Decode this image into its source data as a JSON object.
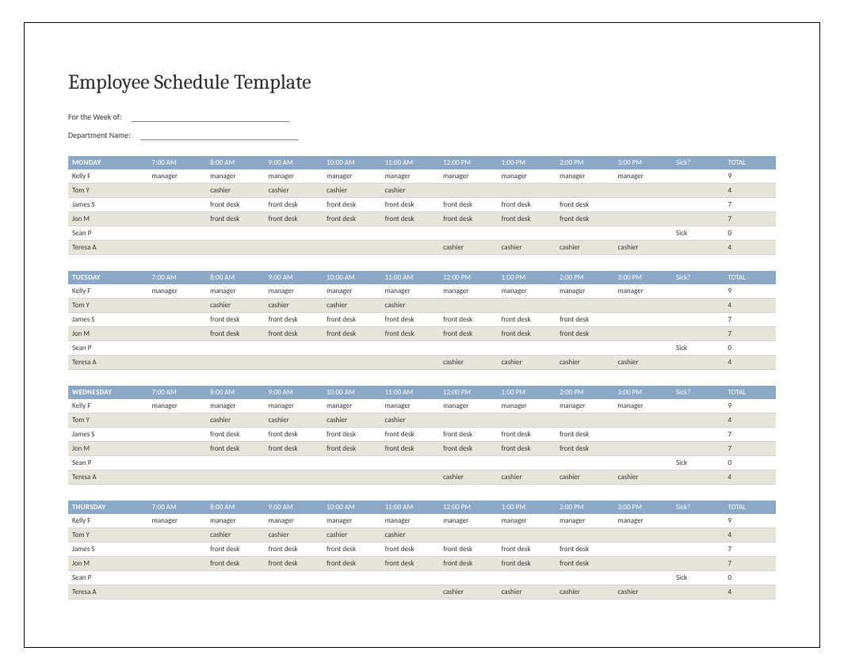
{
  "title": "Employee Schedule Template",
  "fields": {
    "week_label": "For the Week of:",
    "dept_label": "Department Name:"
  },
  "columns": {
    "hours": [
      "7:00 AM",
      "8:00 AM",
      "9:00 AM",
      "10:00 AM",
      "11:00 AM",
      "12:00 PM",
      "1:00 PM",
      "2:00 PM",
      "3:00 PM"
    ],
    "sick": "Sick?",
    "total": "TOTAL"
  },
  "days": [
    {
      "name": "MONDAY",
      "rows": [
        {
          "employee": "Kelly F",
          "cells": [
            "manager",
            "manager",
            "manager",
            "manager",
            "manager",
            "manager",
            "manager",
            "manager",
            "manager"
          ],
          "sick": "",
          "total": "9"
        },
        {
          "employee": "Tom Y",
          "cells": [
            "",
            "cashier",
            "cashier",
            "cashier",
            "cashier",
            "",
            "",
            "",
            ""
          ],
          "sick": "",
          "total": "4"
        },
        {
          "employee": "James S",
          "cells": [
            "",
            "front desk",
            "front desk",
            "front desk",
            "front desk",
            "front desk",
            "front desk",
            "front desk",
            ""
          ],
          "sick": "",
          "total": "7"
        },
        {
          "employee": "Jon M",
          "cells": [
            "",
            "front desk",
            "front desk",
            "front desk",
            "front desk",
            "front desk",
            "front desk",
            "front desk",
            ""
          ],
          "sick": "",
          "total": "7"
        },
        {
          "employee": "Sean P",
          "cells": [
            "",
            "",
            "",
            "",
            "",
            "",
            "",
            "",
            ""
          ],
          "sick": "Sick",
          "total": "0"
        },
        {
          "employee": "Teresa A",
          "cells": [
            "",
            "",
            "",
            "",
            "",
            "cashier",
            "cashier",
            "cashier",
            "cashier"
          ],
          "sick": "",
          "total": "4"
        }
      ]
    },
    {
      "name": "TUESDAY",
      "rows": [
        {
          "employee": "Kelly F",
          "cells": [
            "manager",
            "manager",
            "manager",
            "manager",
            "manager",
            "manager",
            "manager",
            "manager",
            "manager"
          ],
          "sick": "",
          "total": "9"
        },
        {
          "employee": "Tom Y",
          "cells": [
            "",
            "cashier",
            "cashier",
            "cashier",
            "cashier",
            "",
            "",
            "",
            ""
          ],
          "sick": "",
          "total": "4"
        },
        {
          "employee": "James S",
          "cells": [
            "",
            "front desk",
            "front desk",
            "front desk",
            "front desk",
            "front desk",
            "front desk",
            "front desk",
            ""
          ],
          "sick": "",
          "total": "7"
        },
        {
          "employee": "Jon M",
          "cells": [
            "",
            "front desk",
            "front desk",
            "front desk",
            "front desk",
            "front desk",
            "front desk",
            "front desk",
            ""
          ],
          "sick": "",
          "total": "7"
        },
        {
          "employee": "Sean P",
          "cells": [
            "",
            "",
            "",
            "",
            "",
            "",
            "",
            "",
            ""
          ],
          "sick": "Sick",
          "total": "0"
        },
        {
          "employee": "Teresa A",
          "cells": [
            "",
            "",
            "",
            "",
            "",
            "cashier",
            "cashier",
            "cashier",
            "cashier"
          ],
          "sick": "",
          "total": "4"
        }
      ]
    },
    {
      "name": "WEDNESDAY",
      "rows": [
        {
          "employee": "Kelly F",
          "cells": [
            "manager",
            "manager",
            "manager",
            "manager",
            "manager",
            "manager",
            "manager",
            "manager",
            "manager"
          ],
          "sick": "",
          "total": "9"
        },
        {
          "employee": "Tom Y",
          "cells": [
            "",
            "cashier",
            "cashier",
            "cashier",
            "cashier",
            "",
            "",
            "",
            ""
          ],
          "sick": "",
          "total": "4"
        },
        {
          "employee": "James S",
          "cells": [
            "",
            "front desk",
            "front desk",
            "front desk",
            "front desk",
            "front desk",
            "front desk",
            "front desk",
            ""
          ],
          "sick": "",
          "total": "7"
        },
        {
          "employee": "Jon M",
          "cells": [
            "",
            "front desk",
            "front desk",
            "front desk",
            "front desk",
            "front desk",
            "front desk",
            "front desk",
            ""
          ],
          "sick": "",
          "total": "7"
        },
        {
          "employee": "Sean P",
          "cells": [
            "",
            "",
            "",
            "",
            "",
            "",
            "",
            "",
            ""
          ],
          "sick": "Sick",
          "total": "0"
        },
        {
          "employee": "Teresa A",
          "cells": [
            "",
            "",
            "",
            "",
            "",
            "cashier",
            "cashier",
            "cashier",
            "cashier"
          ],
          "sick": "",
          "total": "4"
        }
      ]
    },
    {
      "name": "THURSDAY",
      "rows": [
        {
          "employee": "Kelly F",
          "cells": [
            "manager",
            "manager",
            "manager",
            "manager",
            "manager",
            "manager",
            "manager",
            "manager",
            "manager"
          ],
          "sick": "",
          "total": "9"
        },
        {
          "employee": "Tom Y",
          "cells": [
            "",
            "cashier",
            "cashier",
            "cashier",
            "cashier",
            "",
            "",
            "",
            ""
          ],
          "sick": "",
          "total": "4"
        },
        {
          "employee": "James S",
          "cells": [
            "",
            "front desk",
            "front desk",
            "front desk",
            "front desk",
            "front desk",
            "front desk",
            "front desk",
            ""
          ],
          "sick": "",
          "total": "7"
        },
        {
          "employee": "Jon M",
          "cells": [
            "",
            "front desk",
            "front desk",
            "front desk",
            "front desk",
            "front desk",
            "front desk",
            "front desk",
            ""
          ],
          "sick": "",
          "total": "7"
        },
        {
          "employee": "Sean P",
          "cells": [
            "",
            "",
            "",
            "",
            "",
            "",
            "",
            "",
            ""
          ],
          "sick": "Sick",
          "total": "0"
        },
        {
          "employee": "Teresa A",
          "cells": [
            "",
            "",
            "",
            "",
            "",
            "cashier",
            "cashier",
            "cashier",
            "cashier"
          ],
          "sick": "",
          "total": "4"
        }
      ]
    }
  ]
}
